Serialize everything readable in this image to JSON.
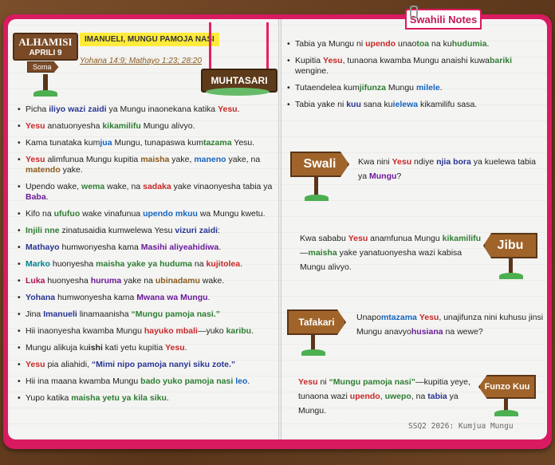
{
  "tab": {
    "label": "Swahili Notes"
  },
  "date_sign": {
    "day": "ALHAMISI",
    "date": "APRILI 9",
    "action": "Soma"
  },
  "title": "IMANUELI, MUNGU PAMOJA NASI",
  "scripture": "Yohana 14:9; Mathayo 1:23; 28:20",
  "summary_label": "MUHTASARI",
  "left_bullets": [
    [
      {
        "t": "Picha "
      },
      {
        "t": "iliyo wazi zaidi",
        "c": "navy"
      },
      {
        "t": " ya Mungu inaonekana katika "
      },
      {
        "t": "Yesu",
        "c": "red"
      },
      {
        "t": "."
      }
    ],
    [
      {
        "t": "Yesu",
        "c": "red"
      },
      {
        "t": " anatuonyesha "
      },
      {
        "t": "kikamilifu",
        "c": "green"
      },
      {
        "t": " Mungu alivyo."
      }
    ],
    [
      {
        "t": "Kama tunataka kum"
      },
      {
        "t": "jua",
        "c": "blue"
      },
      {
        "t": " Mungu, tunapaswa kum"
      },
      {
        "t": "tazama",
        "c": "green"
      },
      {
        "t": " Yesu."
      }
    ],
    [
      {
        "t": "Yesu",
        "c": "red"
      },
      {
        "t": " alimfunua Mungu kupitia "
      },
      {
        "t": "maisha",
        "c": "brown"
      },
      {
        "t": " yake, "
      },
      {
        "t": "maneno",
        "c": "blue"
      },
      {
        "t": " yake, na "
      },
      {
        "t": "matendo",
        "c": "brown"
      },
      {
        "t": " yake."
      }
    ],
    [
      {
        "t": "Upendo wake, "
      },
      {
        "t": "wema",
        "c": "green"
      },
      {
        "t": " wake, na "
      },
      {
        "t": "sadaka",
        "c": "red"
      },
      {
        "t": " yake vinaonyesha tabia ya "
      },
      {
        "t": "Baba",
        "c": "purple"
      },
      {
        "t": "."
      }
    ],
    [
      {
        "t": "Kifo na "
      },
      {
        "t": "ufufuo",
        "c": "green"
      },
      {
        "t": " wake vinafunua "
      },
      {
        "t": "upendo mkuu",
        "c": "blue"
      },
      {
        "t": " wa Mungu kwetu."
      }
    ],
    [
      {
        "t": "Injili nne",
        "c": "green"
      },
      {
        "t": " zinatusaidia kumwelewa Yesu "
      },
      {
        "t": "vizuri zaidi",
        "c": "navy"
      },
      {
        "t": ":"
      }
    ],
    [
      {
        "t": "Mathayo",
        "c": "navy"
      },
      {
        "t": " humwonyesha kama "
      },
      {
        "t": "Masihi aliyeahidiwa",
        "c": "purple"
      },
      {
        "t": "."
      }
    ],
    [
      {
        "t": "Marko",
        "c": "teal"
      },
      {
        "t": " huonyesha "
      },
      {
        "t": "maisha yake ya huduma",
        "c": "green"
      },
      {
        "t": " na "
      },
      {
        "t": "kujitolea",
        "c": "red"
      },
      {
        "t": "."
      }
    ],
    [
      {
        "t": "Luka",
        "c": "magenta"
      },
      {
        "t": " huonyesha "
      },
      {
        "t": "huruma",
        "c": "purple"
      },
      {
        "t": " yake na "
      },
      {
        "t": "ubinadamu",
        "c": "brown"
      },
      {
        "t": " wake."
      }
    ],
    [
      {
        "t": "Yohana",
        "c": "navy"
      },
      {
        "t": " humwonyesha kama "
      },
      {
        "t": "Mwana wa Mungu",
        "c": "purple"
      },
      {
        "t": "."
      }
    ],
    [
      {
        "t": "Jina "
      },
      {
        "t": "Imanueli",
        "c": "navy"
      },
      {
        "t": " linamaanisha "
      },
      {
        "t": "“Mungu pamoja nasi.”",
        "c": "green"
      }
    ],
    [
      {
        "t": "Hii inaonyesha kwamba Mungu "
      },
      {
        "t": "hayuko mbali",
        "c": "red"
      },
      {
        "t": "—yuko "
      },
      {
        "t": "karibu",
        "c": "green"
      },
      {
        "t": "."
      }
    ],
    [
      {
        "t": "Mungu alikuja ku"
      },
      {
        "t": "ishi",
        "c": "k"
      },
      {
        "t": " kati yetu kupitia "
      },
      {
        "t": "Yesu",
        "c": "red"
      },
      {
        "t": "."
      }
    ],
    [
      {
        "t": "Yesu",
        "c": "red"
      },
      {
        "t": " pia aliahidi, "
      },
      {
        "t": "“Mimi nipo pamoja nanyi siku zote.”",
        "c": "navy"
      }
    ],
    [
      {
        "t": "Hii ina maana kwamba Mungu "
      },
      {
        "t": "bado yuko pamoja nasi",
        "c": "green"
      },
      {
        "t": " "
      },
      {
        "t": "leo",
        "c": "blue"
      },
      {
        "t": "."
      }
    ],
    [
      {
        "t": "Yupo katika "
      },
      {
        "t": "maisha yetu ya kila siku",
        "c": "green"
      },
      {
        "t": "."
      }
    ]
  ],
  "right_bullets": [
    [
      {
        "t": "Tabia ya Mungu ni "
      },
      {
        "t": "upendo",
        "c": "red"
      },
      {
        "t": " unao"
      },
      {
        "t": "toa",
        "c": "green"
      },
      {
        "t": " na ku"
      },
      {
        "t": "hudumia",
        "c": "green"
      },
      {
        "t": "."
      }
    ],
    [
      {
        "t": "Kupitia "
      },
      {
        "t": "Yesu",
        "c": "red"
      },
      {
        "t": ", tunaona kwamba Mungu anaishi kuwa"
      },
      {
        "t": "bariki",
        "c": "green"
      },
      {
        "t": " wengine."
      }
    ],
    [
      {
        "t": "Tutaendelea kum"
      },
      {
        "t": "jifunza",
        "c": "green"
      },
      {
        "t": " Mungu "
      },
      {
        "t": "milele",
        "c": "blue"
      },
      {
        "t": "."
      }
    ],
    [
      {
        "t": "Tabia yake ni "
      },
      {
        "t": "kuu",
        "c": "navy"
      },
      {
        "t": " sana ku"
      },
      {
        "t": "ielewa",
        "c": "blue"
      },
      {
        "t": " kikamilifu sasa."
      }
    ]
  ],
  "swali": {
    "label": "Swali",
    "text": [
      {
        "t": "Kwa nini "
      },
      {
        "t": "Yesu",
        "c": "red"
      },
      {
        "t": " ndiye "
      },
      {
        "t": "njia bora",
        "c": "navy"
      },
      {
        "t": " ya kuelewa tabia ya "
      },
      {
        "t": "Mungu",
        "c": "purple"
      },
      {
        "t": "?"
      }
    ]
  },
  "jibu": {
    "label": "Jibu",
    "text": [
      {
        "t": "Kwa sababu "
      },
      {
        "t": "Yesu",
        "c": "red"
      },
      {
        "t": " anamfunua Mungu "
      },
      {
        "t": "kikamilifu",
        "c": "green"
      },
      {
        "t": "—"
      },
      {
        "t": "maisha",
        "c": "green"
      },
      {
        "t": " yake yanatuonyesha wazi kabisa Mungu alivyo."
      }
    ]
  },
  "tafakari": {
    "label": "Tafakari",
    "text": [
      {
        "t": "Unapo"
      },
      {
        "t": "mtazama",
        "c": "blue"
      },
      {
        "t": " "
      },
      {
        "t": "Yesu",
        "c": "red"
      },
      {
        "t": ", unajifunza nini kuhusu jinsi Mungu anavyo"
      },
      {
        "t": "husiana",
        "c": "purple"
      },
      {
        "t": " na wewe?"
      }
    ]
  },
  "funzo": {
    "label": "Funzo Kuu",
    "text": [
      {
        "t": "Yesu",
        "c": "red"
      },
      {
        "t": " ni "
      },
      {
        "t": "“Mungu pamoja nasi”",
        "c": "green"
      },
      {
        "t": "—kupitia yeye, tunaona wazi "
      },
      {
        "t": "upendo",
        "c": "red"
      },
      {
        "t": ", "
      },
      {
        "t": "uwepo",
        "c": "green"
      },
      {
        "t": ", na "
      },
      {
        "t": "tabia",
        "c": "navy"
      },
      {
        "t": " ya Mungu."
      }
    ]
  },
  "footer": "SSQ2 2026: Kumjua Mungu"
}
